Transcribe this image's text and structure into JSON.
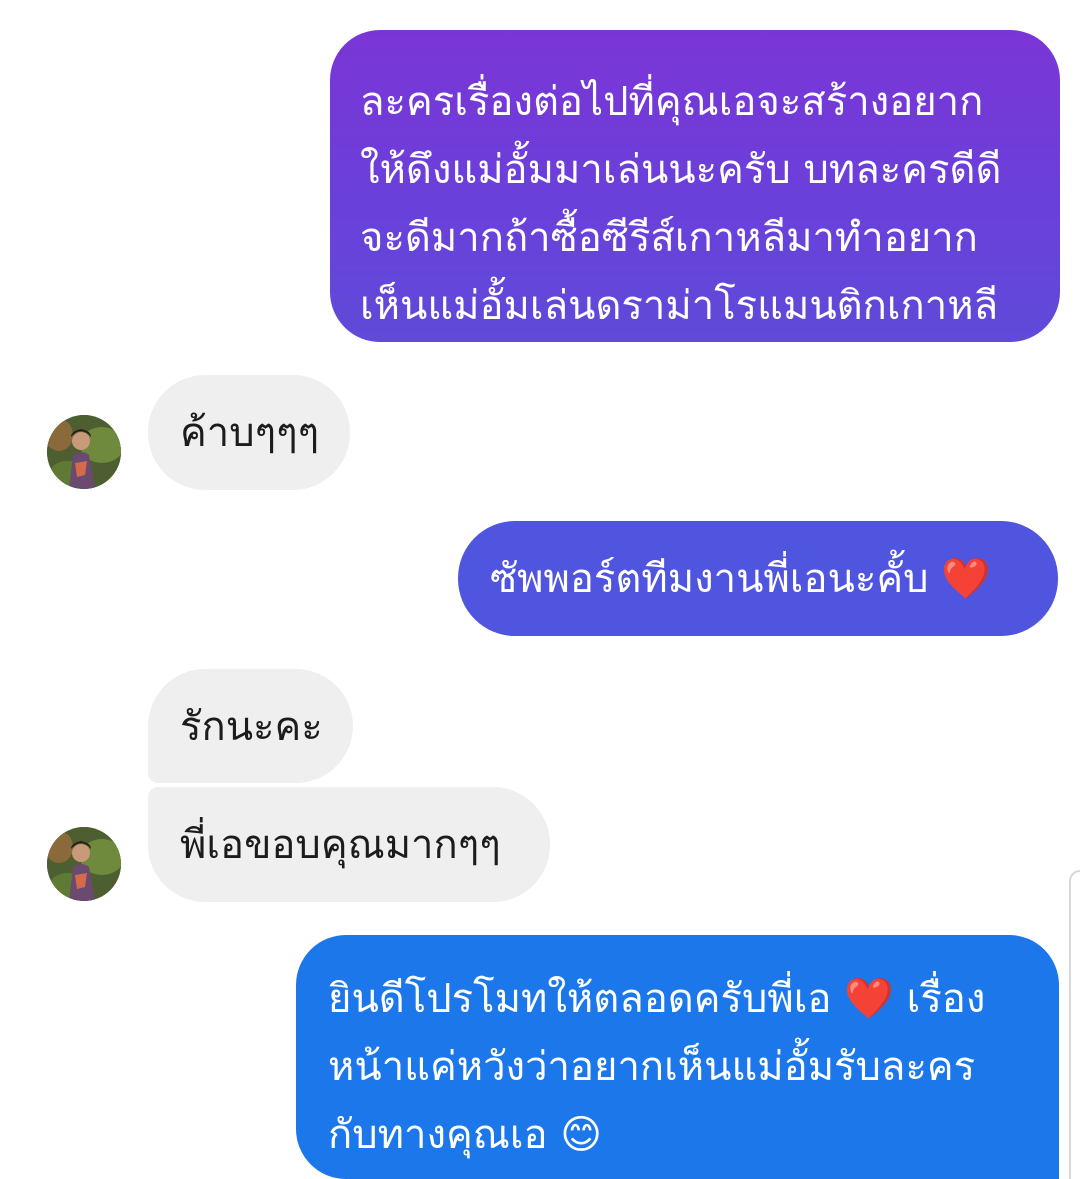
{
  "conversation": {
    "messages": [
      {
        "sender": "self",
        "text": "ละครเรื่องต่อไปที่คุณเอจะสร้างอยาก\nให้ดึงแม่อั้มมาเล่นนะครับ บทละครดีดี\nจะดีมากถ้าซื้อซีรีส์เกาหลีมาทำอยาก\nเห็นแม่อั้มเล่นดราม่าโรแมนติกเกาหลี"
      },
      {
        "sender": "other",
        "text": "ค้าบๆๆๆ"
      },
      {
        "sender": "self",
        "text": "ซัพพอร์ตทีมงานพี่เอนะคั้บ ❤️"
      },
      {
        "sender": "other",
        "text": "รักนะคะ"
      },
      {
        "sender": "other",
        "text": "พี่เอขอบคุณมากๆๆ"
      },
      {
        "sender": "self",
        "text": "ยินดีโปรโมทให้ตลอดครับพี่เอ ❤️ เรื่อง\nหน้าแค่หวังว่าอยากเห็นแม่อั้มรับละคร\nกับทางคุณเอ 😊"
      }
    ]
  },
  "colors": {
    "outgoing_gradient_top": "#7b35d6",
    "outgoing_gradient_bottom": "#5f4ad9",
    "outgoing_mid": "#4f55de",
    "outgoing_bottom": "#1c78ea",
    "incoming": "#efefef",
    "incoming_text": "#1c1c1c"
  }
}
